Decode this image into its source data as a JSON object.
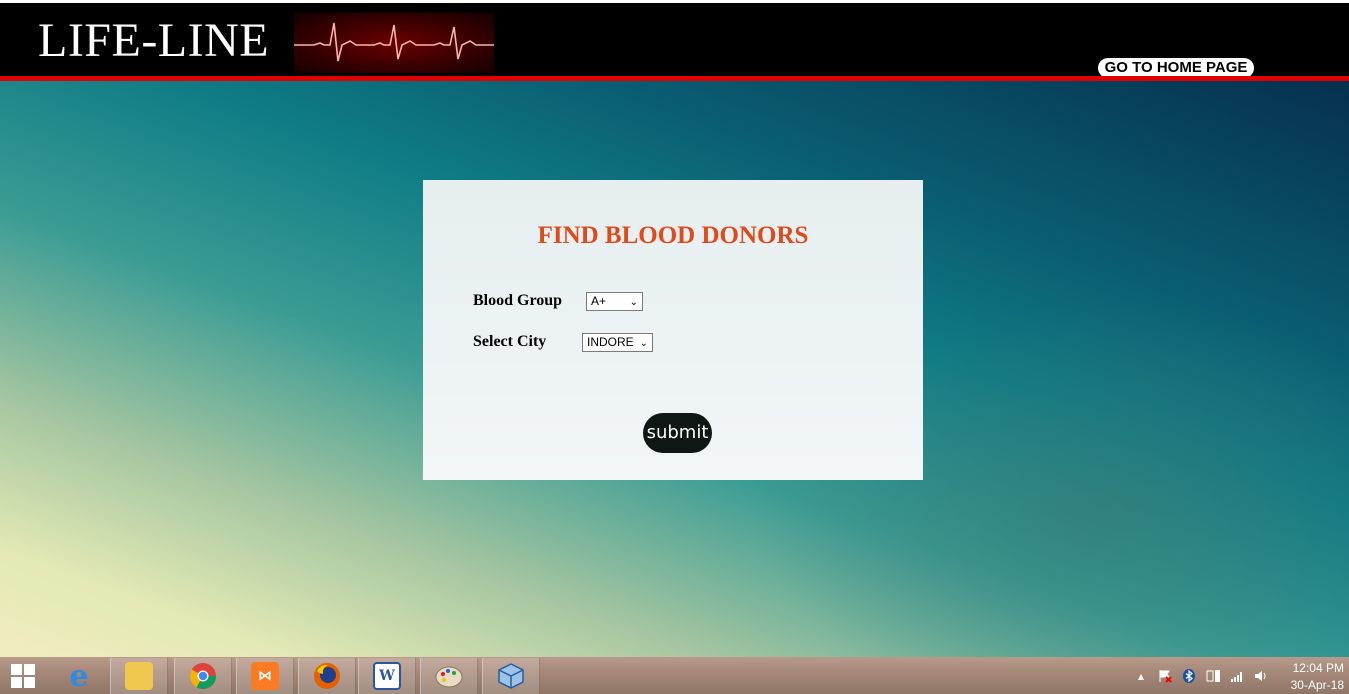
{
  "header": {
    "site_title": "LIFE-LINE",
    "logo_icon": "ecg-heartbeat-icon",
    "home_button_label": "GO TO HOME PAGE",
    "brand_colors": {
      "header_bg": "#000000",
      "accent_line": "#e00000"
    }
  },
  "form": {
    "title": "FIND BLOOD DONORS",
    "title_color": "#e04a1a",
    "blood_group_label": "Blood Group",
    "blood_group_value": "A+",
    "city_label": "Select City",
    "city_value": "INDORE",
    "submit_label": "submit"
  },
  "taskbar": {
    "start_icon": "windows-start-icon",
    "apps": [
      {
        "name": "internet-explorer-icon"
      },
      {
        "name": "file-explorer-icon"
      },
      {
        "name": "chrome-icon"
      },
      {
        "name": "xampp-icon"
      },
      {
        "name": "firefox-icon"
      },
      {
        "name": "word-icon"
      },
      {
        "name": "paint-icon"
      },
      {
        "name": "virtualbox-icon"
      }
    ],
    "tray_icons": [
      "show-hidden-icons-icon",
      "action-center-flag-icon",
      "bluetooth-icon",
      "power-icon",
      "network-signal-icon",
      "volume-icon"
    ],
    "clock": {
      "time": "12:04 PM",
      "date": "30-Apr-18"
    }
  }
}
